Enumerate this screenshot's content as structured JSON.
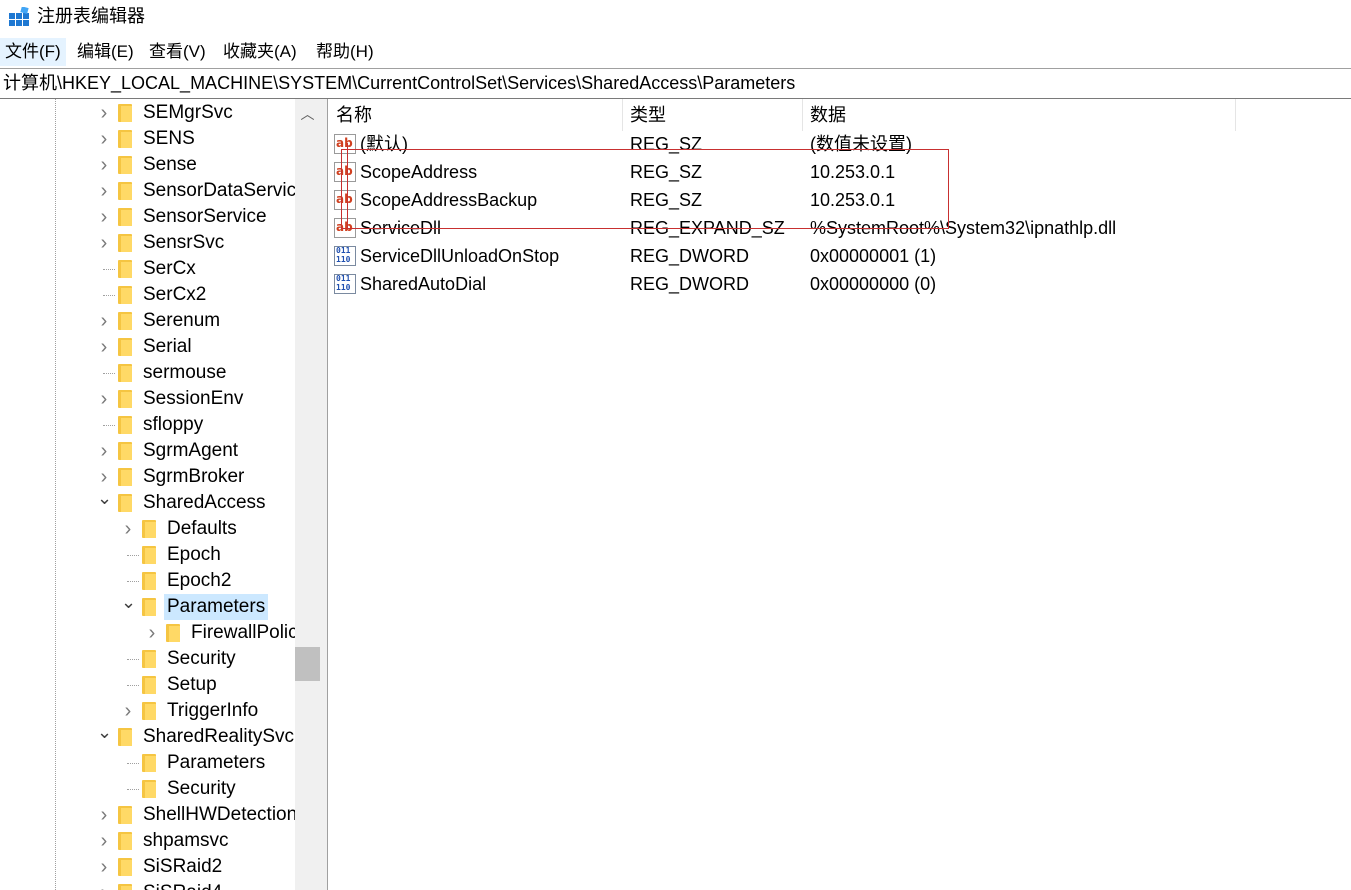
{
  "window": {
    "title": "注册表编辑器",
    "icon": "registry-editor-icon"
  },
  "menu": [
    {
      "label": "文件(F)",
      "active": true
    },
    {
      "label": "编辑(E)"
    },
    {
      "label": "查看(V)"
    },
    {
      "label": "收藏夹(A)"
    },
    {
      "label": "帮助(H)"
    }
  ],
  "address": "计算机\\HKEY_LOCAL_MACHINE\\SYSTEM\\CurrentControlSet\\Services\\SharedAccess\\Parameters",
  "tree": [
    {
      "label": "SEMgrSvc",
      "level": 0,
      "expander": "collapsed"
    },
    {
      "label": "SENS",
      "level": 0,
      "expander": "collapsed"
    },
    {
      "label": "Sense",
      "level": 0,
      "expander": "collapsed"
    },
    {
      "label": "SensorDataServic",
      "level": 0,
      "expander": "collapsed"
    },
    {
      "label": "SensorService",
      "level": 0,
      "expander": "collapsed"
    },
    {
      "label": "SensrSvc",
      "level": 0,
      "expander": "collapsed"
    },
    {
      "label": "SerCx",
      "level": 0,
      "expander": "none"
    },
    {
      "label": "SerCx2",
      "level": 0,
      "expander": "none"
    },
    {
      "label": "Serenum",
      "level": 0,
      "expander": "collapsed"
    },
    {
      "label": "Serial",
      "level": 0,
      "expander": "collapsed"
    },
    {
      "label": "sermouse",
      "level": 0,
      "expander": "none"
    },
    {
      "label": "SessionEnv",
      "level": 0,
      "expander": "collapsed"
    },
    {
      "label": "sfloppy",
      "level": 0,
      "expander": "none"
    },
    {
      "label": "SgrmAgent",
      "level": 0,
      "expander": "collapsed"
    },
    {
      "label": "SgrmBroker",
      "level": 0,
      "expander": "collapsed"
    },
    {
      "label": "SharedAccess",
      "level": 0,
      "expander": "expanded"
    },
    {
      "label": "Defaults",
      "level": 1,
      "expander": "collapsed"
    },
    {
      "label": "Epoch",
      "level": 1,
      "expander": "none"
    },
    {
      "label": "Epoch2",
      "level": 1,
      "expander": "none"
    },
    {
      "label": "Parameters",
      "level": 1,
      "expander": "expanded",
      "selected": true
    },
    {
      "label": "FirewallPolic",
      "level": 2,
      "expander": "collapsed"
    },
    {
      "label": "Security",
      "level": 1,
      "expander": "none"
    },
    {
      "label": "Setup",
      "level": 1,
      "expander": "none"
    },
    {
      "label": "TriggerInfo",
      "level": 1,
      "expander": "collapsed"
    },
    {
      "label": "SharedRealitySvc",
      "level": 0,
      "expander": "expanded"
    },
    {
      "label": "Parameters",
      "level": 1,
      "expander": "none"
    },
    {
      "label": "Security",
      "level": 1,
      "expander": "none"
    },
    {
      "label": "ShellHWDetection",
      "level": 0,
      "expander": "collapsed"
    },
    {
      "label": "shpamsvc",
      "level": 0,
      "expander": "collapsed"
    },
    {
      "label": "SiSRaid2",
      "level": 0,
      "expander": "collapsed"
    },
    {
      "label": "SiSRaid4",
      "level": 0,
      "expander": "collapsed"
    }
  ],
  "columns": {
    "name": "名称",
    "type": "类型",
    "data": "数据"
  },
  "values": [
    {
      "name": "(默认)",
      "type": "REG_SZ",
      "data": "(数值未设置)",
      "icon": "string-value-icon"
    },
    {
      "name": "ScopeAddress",
      "type": "REG_SZ",
      "data": "10.253.0.1",
      "icon": "string-value-icon"
    },
    {
      "name": "ScopeAddressBackup",
      "type": "REG_SZ",
      "data": "10.253.0.1",
      "icon": "string-value-icon"
    },
    {
      "name": "ServiceDll",
      "type": "REG_EXPAND_SZ",
      "data": "%SystemRoot%\\System32\\ipnathlp.dll",
      "icon": "string-value-icon"
    },
    {
      "name": "ServiceDllUnloadOnStop",
      "type": "REG_DWORD",
      "data": "0x00000001 (1)",
      "icon": "binary-value-icon"
    },
    {
      "name": "SharedAutoDial",
      "type": "REG_DWORD",
      "data": "0x00000000 (0)",
      "icon": "binary-value-icon"
    }
  ],
  "icon_text": {
    "string": "ab",
    "binary": "011\n110"
  },
  "colors": {
    "selection": "#cce8ff",
    "menu_active": "#e5f3ff",
    "annotation": "#c83030",
    "folder": "#ffd966"
  }
}
